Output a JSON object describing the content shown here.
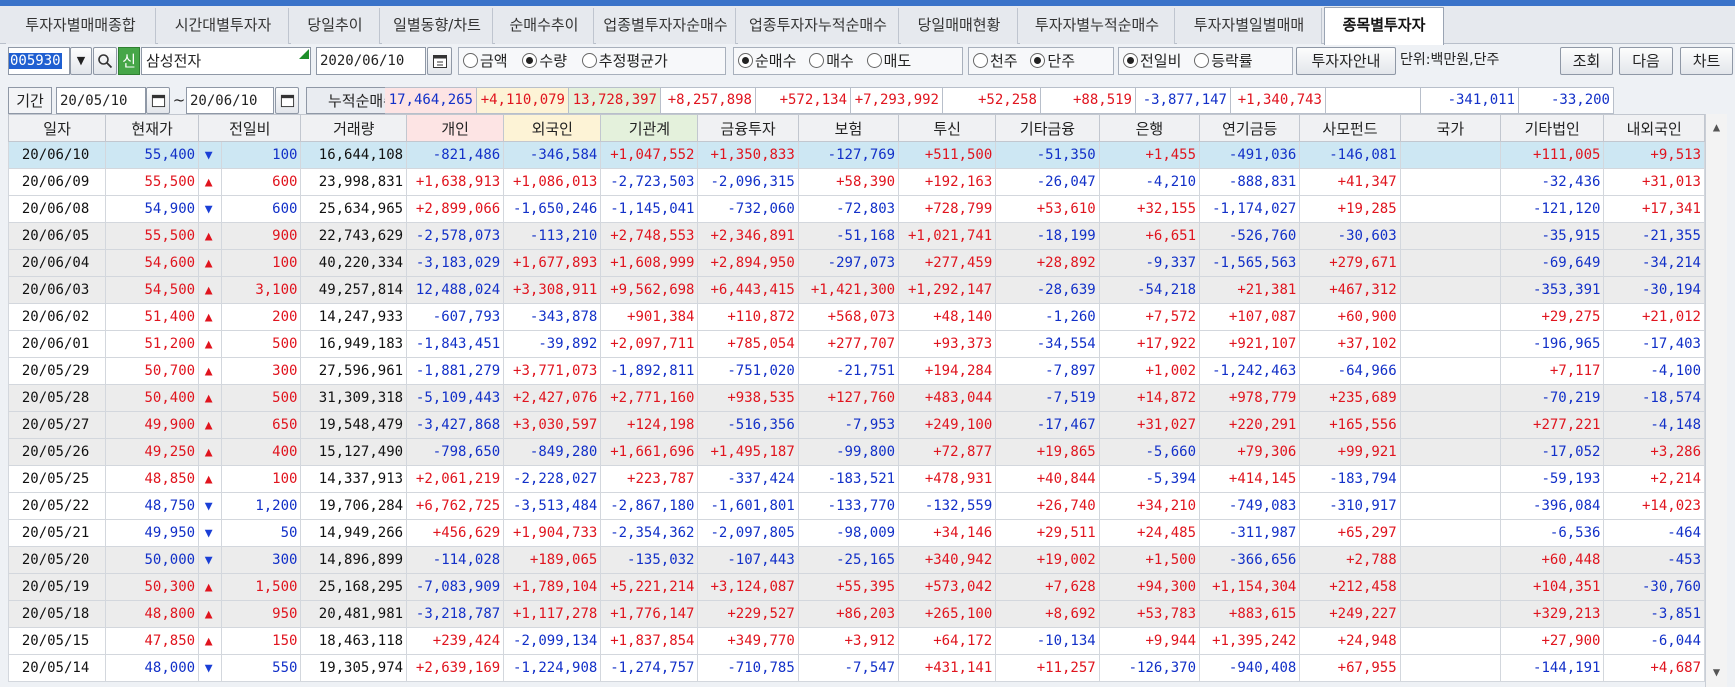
{
  "tabs": [
    "투자자별매매종합",
    "시간대별투자자",
    "당일추이",
    "일별동향/차트",
    "순매수추이",
    "업종별투자자순매수",
    "업종투자자누적순매수",
    "당일매매현황",
    "투자자별누적순매수",
    "투자자별일별매매",
    "종목별투자자"
  ],
  "active_tab": 10,
  "toolbar": {
    "code": "005930",
    "credit_badge": "신",
    "stock_name": "삼성전자",
    "date": "2020/06/10",
    "opt1": [
      "금액",
      "수량",
      "추정평균가"
    ],
    "opt2": [
      "순매수",
      "매수",
      "매도"
    ],
    "opt3": [
      "천주",
      "단주"
    ],
    "opt4": [
      "전일비",
      "등락률"
    ],
    "investor_btn": "투자자안내",
    "unit": "단위:백만원,단주",
    "query_btn": "조회",
    "next_btn": "다음",
    "chart_btn": "차트"
  },
  "period": {
    "label": "기간",
    "from": "20/05/10",
    "sep": "~",
    "to": "20/06/10",
    "cum_label": "누적순매수"
  },
  "summary": [
    "17,464,265",
    "+4,110,079",
    "13,728,397",
    "+8,257,898",
    "+572,134",
    "+7,293,992",
    "+52,258",
    "+88,519",
    "-3,877,147",
    "+1,340,743",
    "",
    "-341,011",
    "-33,200"
  ],
  "columns": [
    "일자",
    "현재가",
    "전일비",
    "거래량",
    "개인",
    "외국인",
    "기관계",
    "금융투자",
    "보험",
    "투신",
    "기타금융",
    "은행",
    "연기금등",
    "사모펀드",
    "국가",
    "기타법인",
    "내외국인"
  ],
  "rows": [
    [
      "20/06/10",
      "55,400",
      "down",
      "100",
      "16,644,108",
      "-821,486",
      "-346,584",
      "+1,047,552",
      "+1,350,833",
      "-127,769",
      "+511,500",
      "-51,350",
      "+1,455",
      "-491,036",
      "-146,081",
      "",
      "+111,005",
      "+9,513"
    ],
    [
      "20/06/09",
      "55,500",
      "up",
      "600",
      "23,998,831",
      "+1,638,913",
      "+1,086,013",
      "-2,723,503",
      "-2,096,315",
      "+58,390",
      "+192,163",
      "-26,047",
      "-4,210",
      "-888,831",
      "+41,347",
      "",
      "-32,436",
      "+31,013"
    ],
    [
      "20/06/08",
      "54,900",
      "down",
      "600",
      "25,634,965",
      "+2,899,066",
      "-1,650,246",
      "-1,145,041",
      "-732,060",
      "-72,803",
      "+728,799",
      "+53,610",
      "+32,155",
      "-1,174,027",
      "+19,285",
      "",
      "-121,120",
      "+17,341"
    ],
    [
      "20/06/05",
      "55,500",
      "up",
      "900",
      "22,743,629",
      "-2,578,073",
      "-113,210",
      "+2,748,553",
      "+2,346,891",
      "-51,168",
      "+1,021,741",
      "-18,199",
      "+6,651",
      "-526,760",
      "-30,603",
      "",
      "-35,915",
      "-21,355"
    ],
    [
      "20/06/04",
      "54,600",
      "up",
      "100",
      "40,220,334",
      "-3,183,029",
      "+1,677,893",
      "+1,608,999",
      "+2,894,950",
      "-297,073",
      "+277,459",
      "+28,892",
      "-9,337",
      "-1,565,563",
      "+279,671",
      "",
      "-69,649",
      "-34,214"
    ],
    [
      "20/06/03",
      "54,500",
      "up",
      "3,100",
      "49,257,814",
      "12,488,024",
      "+3,308,911",
      "+9,562,698",
      "+6,443,415",
      "+1,421,300",
      "+1,292,147",
      "-28,639",
      "-54,218",
      "+21,381",
      "+467,312",
      "",
      "-353,391",
      "-30,194"
    ],
    [
      "20/06/02",
      "51,400",
      "up",
      "200",
      "14,247,933",
      "-607,793",
      "-343,878",
      "+901,384",
      "+110,872",
      "+568,073",
      "+48,140",
      "-1,260",
      "+7,572",
      "+107,087",
      "+60,900",
      "",
      "+29,275",
      "+21,012"
    ],
    [
      "20/06/01",
      "51,200",
      "up",
      "500",
      "16,949,183",
      "-1,843,451",
      "-39,892",
      "+2,097,711",
      "+785,054",
      "+277,707",
      "+93,373",
      "-34,554",
      "+17,922",
      "+921,107",
      "+37,102",
      "",
      "-196,965",
      "-17,403"
    ],
    [
      "20/05/29",
      "50,700",
      "up",
      "300",
      "27,596,961",
      "-1,881,279",
      "+3,771,073",
      "-1,892,811",
      "-751,020",
      "-21,751",
      "+194,284",
      "-7,897",
      "+1,002",
      "-1,242,463",
      "-64,966",
      "",
      "+7,117",
      "-4,100"
    ],
    [
      "20/05/28",
      "50,400",
      "up",
      "500",
      "31,309,318",
      "-5,109,443",
      "+2,427,076",
      "+2,771,160",
      "+938,535",
      "+127,760",
      "+483,044",
      "-7,519",
      "+14,872",
      "+978,779",
      "+235,689",
      "",
      "-70,219",
      "-18,574"
    ],
    [
      "20/05/27",
      "49,900",
      "up",
      "650",
      "19,548,479",
      "-3,427,868",
      "+3,030,597",
      "+124,198",
      "-516,356",
      "-7,953",
      "+249,100",
      "-17,467",
      "+31,027",
      "+220,291",
      "+165,556",
      "",
      "+277,221",
      "-4,148"
    ],
    [
      "20/05/26",
      "49,250",
      "up",
      "400",
      "15,127,490",
      "-798,650",
      "-849,280",
      "+1,661,696",
      "+1,495,187",
      "-99,800",
      "+72,877",
      "+19,865",
      "-5,660",
      "+79,306",
      "+99,921",
      "",
      "-17,052",
      "+3,286"
    ],
    [
      "20/05/25",
      "48,850",
      "up",
      "100",
      "14,337,913",
      "+2,061,219",
      "-2,228,027",
      "+223,787",
      "-337,424",
      "-183,521",
      "+478,931",
      "+40,844",
      "-5,394",
      "+414,145",
      "-183,794",
      "",
      "-59,193",
      "+2,214"
    ],
    [
      "20/05/22",
      "48,750",
      "down",
      "1,200",
      "19,706,284",
      "+6,762,725",
      "-3,513,484",
      "-2,867,180",
      "-1,601,801",
      "-133,770",
      "-132,559",
      "+26,740",
      "+34,210",
      "-749,083",
      "-310,917",
      "",
      "-396,084",
      "+14,023"
    ],
    [
      "20/05/21",
      "49,950",
      "down",
      "50",
      "14,949,266",
      "+456,629",
      "+1,904,733",
      "-2,354,362",
      "-2,097,805",
      "-98,009",
      "+34,146",
      "+29,511",
      "+24,485",
      "-311,987",
      "+65,297",
      "",
      "-6,536",
      "-464"
    ],
    [
      "20/05/20",
      "50,000",
      "down",
      "300",
      "14,896,899",
      "-114,028",
      "+189,065",
      "-135,032",
      "-107,443",
      "-25,165",
      "+340,942",
      "+19,002",
      "+1,500",
      "-366,656",
      "+2,788",
      "",
      "+60,448",
      "-453"
    ],
    [
      "20/05/19",
      "50,300",
      "up",
      "1,500",
      "25,168,295",
      "-7,083,909",
      "+1,789,104",
      "+5,221,214",
      "+3,124,087",
      "+55,395",
      "+573,042",
      "+7,628",
      "+94,300",
      "+1,154,304",
      "+212,458",
      "",
      "+104,351",
      "-30,760"
    ],
    [
      "20/05/18",
      "48,800",
      "up",
      "950",
      "20,481,981",
      "-3,218,787",
      "+1,117,278",
      "+1,776,147",
      "+229,527",
      "+86,203",
      "+265,100",
      "+8,692",
      "+53,783",
      "+883,615",
      "+249,227",
      "",
      "+329,213",
      "-3,851"
    ],
    [
      "20/05/15",
      "47,850",
      "up",
      "150",
      "18,463,118",
      "+239,424",
      "-2,099,134",
      "+1,837,854",
      "+349,770",
      "+3,912",
      "+64,172",
      "-10,134",
      "+9,944",
      "+1,395,242",
      "+24,948",
      "",
      "+27,900",
      "-6,044"
    ],
    [
      "20/05/14",
      "48,000",
      "down",
      "550",
      "19,305,974",
      "+2,639,169",
      "-1,224,908",
      "-1,274,757",
      "-710,785",
      "-7,547",
      "+431,141",
      "+11,257",
      "-126,370",
      "-940,408",
      "+67,955",
      "",
      "-144,191",
      "+4,687"
    ]
  ],
  "colors": {
    "up": "#e0141e",
    "down": "#1230c8",
    "header_individual": "#fde4e4",
    "header_foreign": "#fdf3d6",
    "header_inst": "#e4f1dc",
    "selected_row": "#cde7f3"
  }
}
